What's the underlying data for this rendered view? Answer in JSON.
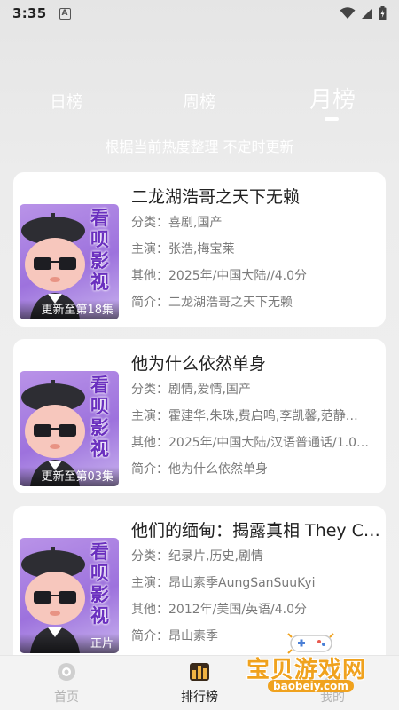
{
  "status_bar": {
    "time": "3:35",
    "notification_icon": "A"
  },
  "tabs": [
    {
      "label": "日榜",
      "active": false
    },
    {
      "label": "周榜",
      "active": false
    },
    {
      "label": "月榜",
      "active": true
    }
  ],
  "subtitle": "根据当前热度整理 不定时更新",
  "labels": {
    "category": "分类：",
    "cast": "主演：",
    "other": "其他：",
    "intro": "简介："
  },
  "poster_brand": [
    "看",
    "呗",
    "影",
    "视"
  ],
  "items": [
    {
      "title": "二龙湖浩哥之天下无赖",
      "category": "喜剧,国产",
      "cast": "张浩,梅宝莱",
      "other": "2025年/中国大陆//4.0分",
      "intro": "二龙湖浩哥之天下无赖",
      "badge": "更新至第18集"
    },
    {
      "title": "他为什么依然单身",
      "category": "剧情,爱情,国产",
      "cast": "霍建华,朱珠,费启鸣,李凯馨,范静…",
      "other": "2025年/中国大陆/汉语普通话/1.0…",
      "intro": "他为什么依然单身",
      "badge": "更新至第03集"
    },
    {
      "title": "他们的缅甸：揭露真相 They C…",
      "category": "纪录片,历史,剧情",
      "cast": "昂山素季AungSanSuuKyi",
      "other": "2012年/美国/英语/4.0分",
      "intro": "昂山素季",
      "badge": "正片"
    }
  ],
  "bottom_nav": [
    {
      "label": "首页",
      "icon": "home-icon",
      "active": false
    },
    {
      "label": "排行榜",
      "icon": "ranking-icon",
      "active": true
    },
    {
      "label": "我的",
      "icon": "profile-icon",
      "active": false
    }
  ],
  "watermark": {
    "text": "宝贝游戏网",
    "url": "baobeiy.com"
  },
  "colors": {
    "background": "#ececec",
    "card": "#ffffff",
    "tab_text": "#ffffff",
    "meta_text": "#7a7a7a",
    "poster_bg": "#9d72dd",
    "watermark": "#f0a21e"
  }
}
